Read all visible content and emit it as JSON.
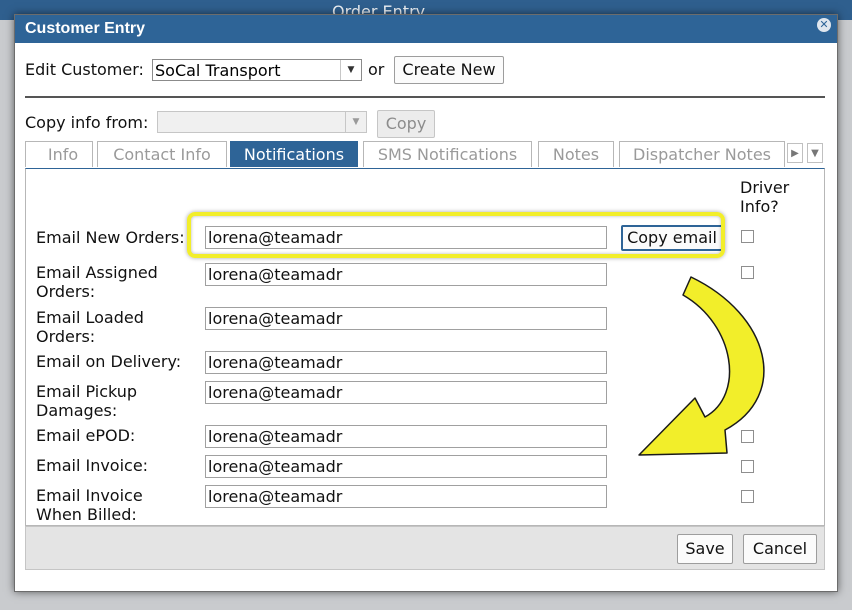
{
  "background": {
    "title": "Order Entry"
  },
  "dialog": {
    "title": "Customer Entry",
    "edit_customer_label": "Edit Customer:",
    "customer_value": "SoCal Transport",
    "or_label": "or",
    "create_new_label": "Create New",
    "copy_info_label": "Copy info from:",
    "copy_info_value": "",
    "copy_button_label": "Copy",
    "tabs": [
      {
        "label": "Info",
        "active": false
      },
      {
        "label": "Contact Info",
        "active": false
      },
      {
        "label": "Notifications",
        "active": true
      },
      {
        "label": "SMS Notifications",
        "active": false
      },
      {
        "label": "Notes",
        "active": false
      },
      {
        "label": "Dispatcher Notes",
        "active": false
      }
    ],
    "driver_info_header_line1": "Driver",
    "driver_info_header_line2": "Info?",
    "copy_email_label": "Copy email",
    "rows": [
      {
        "label_line1": "Email New Orders:",
        "label_line2": "",
        "value": "lorena@teamadr",
        "has_checkbox": true
      },
      {
        "label_line1": "Email Assigned",
        "label_line2": "Orders:",
        "value": "lorena@teamadr",
        "has_checkbox": true
      },
      {
        "label_line1": "Email Loaded",
        "label_line2": "Orders:",
        "value": "lorena@teamadr",
        "has_checkbox": false
      },
      {
        "label_line1": "Email on Delivery:",
        "label_line2": "",
        "value": "lorena@teamadr",
        "has_checkbox": true
      },
      {
        "label_line1": "Email Pickup",
        "label_line2": "Damages:",
        "value": "lorena@teamadr",
        "has_checkbox": true
      },
      {
        "label_line1": "Email ePOD:",
        "label_line2": "",
        "value": "lorena@teamadr",
        "has_checkbox": true
      },
      {
        "label_line1": "Email Invoice:",
        "label_line2": "",
        "value": "lorena@teamadr",
        "has_checkbox": true
      },
      {
        "label_line1": "Email Invoice",
        "label_line2": "When Billed:",
        "value": "lorena@teamadr",
        "has_checkbox": true
      }
    ],
    "save_label": "Save",
    "cancel_label": "Cancel"
  },
  "colors": {
    "titlebar": "#2e6497",
    "active_tab": "#2e6497",
    "highlight": "#f2ee2a",
    "arrow_fill": "#f2ee2a"
  },
  "icons": {
    "close": "close-icon",
    "dropdown": "chevron-down-icon",
    "tab_scroll_left": "chevron-left-icon",
    "tab_scroll_right": "chevron-right-icon",
    "tab_menu": "chevron-down-icon",
    "annotation": "curved-arrow-icon"
  }
}
